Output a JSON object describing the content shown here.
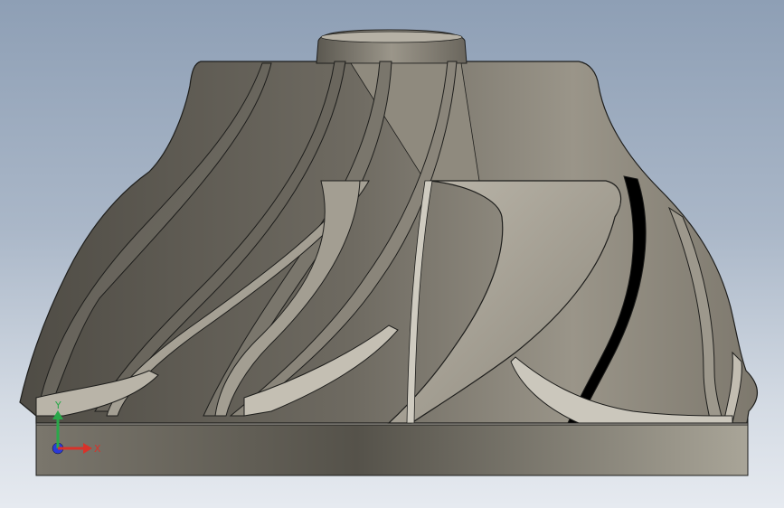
{
  "scene": {
    "model": "impeller",
    "view": "front",
    "colors": {
      "background_top": "#8e9fb5",
      "background_bottom": "#e6eaf0",
      "metal_dark": "#56534b",
      "metal_mid": "#8a857a",
      "metal_light": "#c9c5bb",
      "edge": "#1e1e1c"
    }
  },
  "triad": {
    "x_label": "X",
    "y_label": "Y",
    "x_color": "#d8322a",
    "y_color": "#2aa84a",
    "z_color": "#2a3ad8"
  }
}
